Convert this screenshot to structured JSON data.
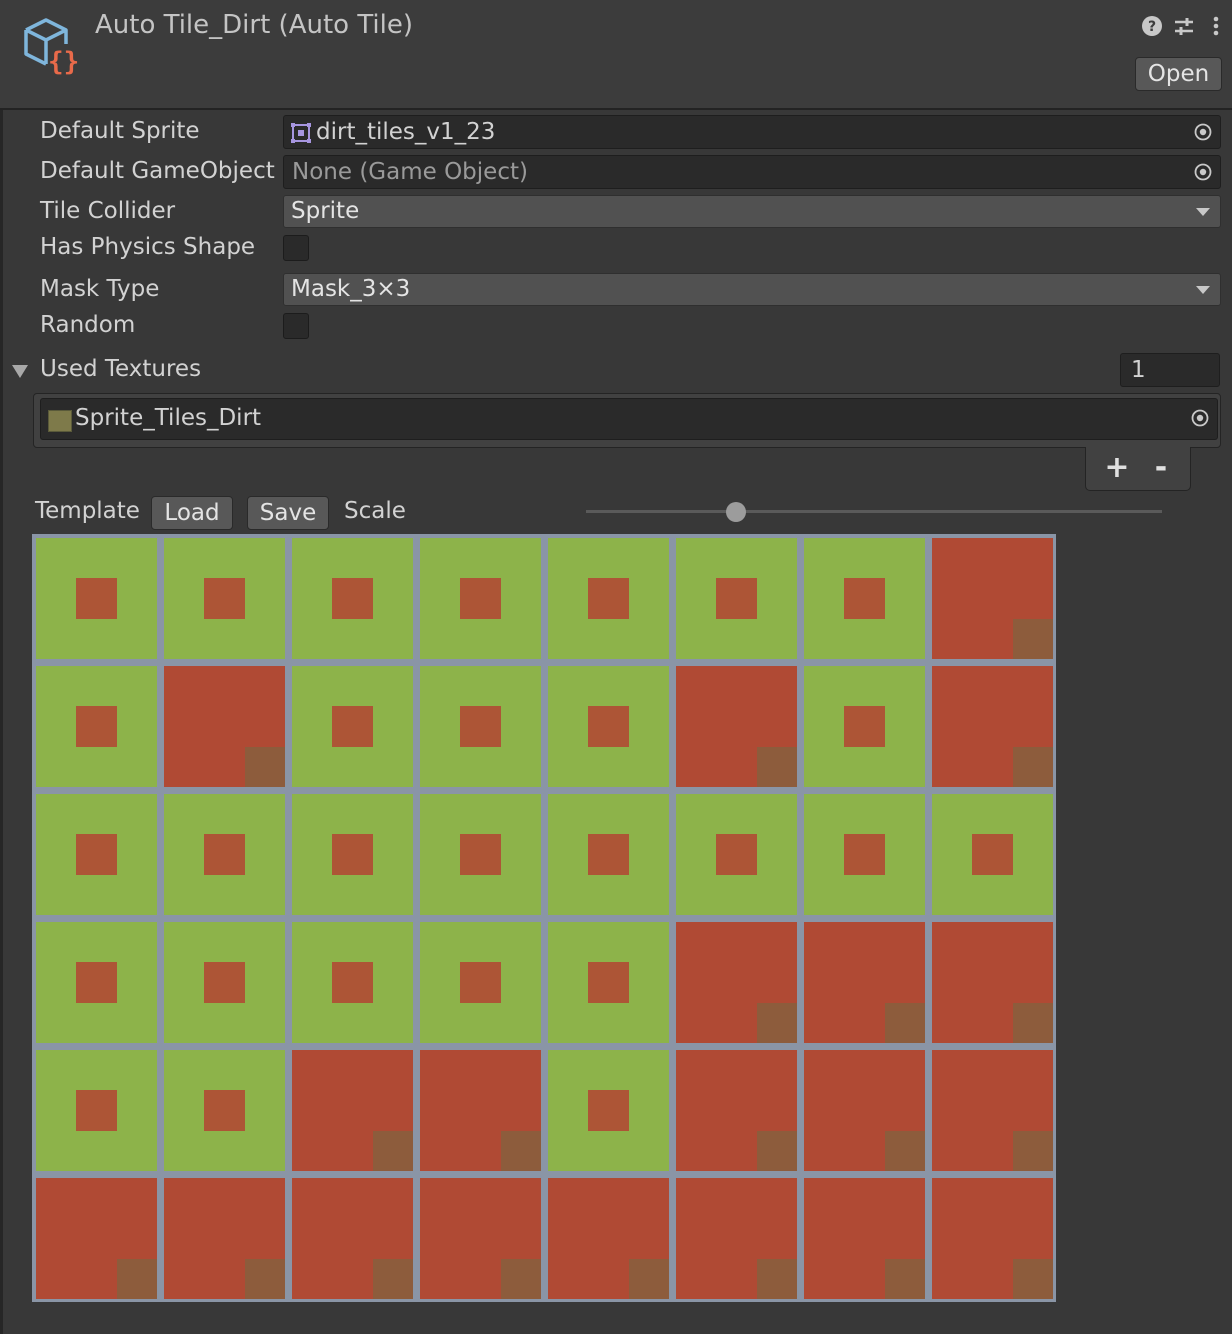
{
  "header": {
    "title": "Auto Tile_Dirt (Auto Tile)",
    "open_label": "Open",
    "icons": [
      "asset-cube-icon",
      "help-icon",
      "settings-sliders-icon",
      "more-vertical-icon"
    ]
  },
  "properties": {
    "default_sprite_label": "Default Sprite",
    "default_sprite_value": "dirt_tiles_v1_23",
    "default_gameobject_label": "Default GameObject",
    "default_gameobject_value": "None (Game Object)",
    "tile_collider_label": "Tile Collider",
    "tile_collider_value": "Sprite",
    "has_physics_shape_label": "Has Physics Shape",
    "has_physics_shape_checked": false,
    "mask_type_label": "Mask Type",
    "mask_type_value": "Mask_3×3",
    "random_label": "Random",
    "random_checked": false
  },
  "used_textures": {
    "label": "Used Textures",
    "count": "1",
    "items": [
      "Sprite_Tiles_Dirt"
    ],
    "add_label": "+",
    "remove_label": "-"
  },
  "template_bar": {
    "template_label": "Template",
    "load_label": "Load",
    "save_label": "Save",
    "scale_label": "Scale",
    "scale_fraction": 0.26
  },
  "tile_grid": {
    "columns": 8,
    "rows": 6,
    "colors": {
      "grass": "#8db34a",
      "dirt": "#b04a34",
      "soil": "#7f6440",
      "grid": "#8a95a6"
    },
    "tiles": [
      [
        "grass",
        "grass",
        "grass",
        "grass",
        "grass",
        "grass",
        "grass",
        "dirt"
      ],
      [
        "grass",
        "dirt",
        "grass",
        "grass",
        "grass",
        "dirt",
        "grass",
        "dirt"
      ],
      [
        "grass",
        "grass",
        "grass",
        "grass",
        "grass",
        "grass",
        "grass",
        "grass"
      ],
      [
        "grass",
        "grass",
        "grass",
        "grass",
        "grass",
        "dirt",
        "dirt",
        "dirt"
      ],
      [
        "grass",
        "grass",
        "dirt",
        "dirt",
        "grass",
        "dirt",
        "dirt",
        "dirt"
      ],
      [
        "dirt",
        "dirt",
        "dirt",
        "dirt",
        "dirt",
        "dirt",
        "dirt",
        "dirt"
      ]
    ]
  }
}
